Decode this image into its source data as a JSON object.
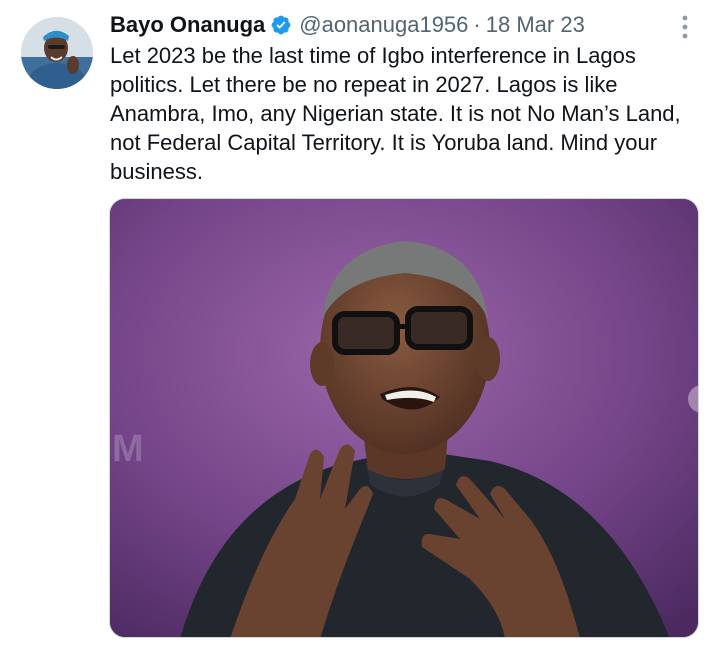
{
  "tweet": {
    "author": {
      "display_name": "Bayo Onanuga",
      "handle": "@aonanuga1956",
      "verified": true,
      "avatar": "profile-photo"
    },
    "separator": "·",
    "timestamp": "18 Mar 23",
    "text": "Let 2023 be the last time of Igbo interference in Lagos politics. Let there be no repeat in 2027. Lagos is like Anambra, Imo, any Nigerian state. It is not No Man’s Land, not Federal Capital Territory. It is Yoruba land. Mind your business.",
    "media": {
      "kind": "photo",
      "description_icon": "photo-image",
      "background_letter": "M"
    },
    "icons": {
      "verified": "verified-badge-icon",
      "more": "more-vertical-icon"
    },
    "colors": {
      "verified_blue": "#1d9bf0",
      "secondary_text": "#536471",
      "primary_text": "#0f1419"
    }
  }
}
